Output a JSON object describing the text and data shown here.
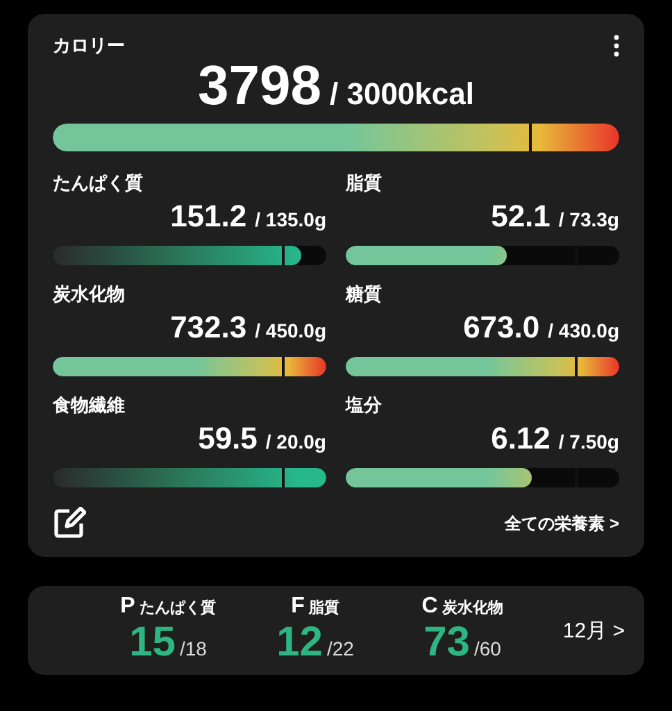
{
  "calorie": {
    "label": "カロリー",
    "value": "3798",
    "target": "/ 3000kcal",
    "level": 1.0,
    "kind": "warm"
  },
  "nutrients": [
    {
      "label": "たんぱく質",
      "value": "151.2",
      "target": "/ 135.0g",
      "level": 0.91,
      "kind": "teal"
    },
    {
      "label": "脂質",
      "value": "52.1",
      "target": "/ 73.3g",
      "level": 0.59,
      "kind": "warm"
    },
    {
      "label": "炭水化物",
      "value": "732.3",
      "target": "/ 450.0g",
      "level": 1.0,
      "kind": "warm"
    },
    {
      "label": "糖質",
      "value": "673.0",
      "target": "/ 430.0g",
      "level": 1.0,
      "kind": "warm"
    },
    {
      "label": "食物繊維",
      "value": "59.5",
      "target": "/ 20.0g",
      "level": 1.0,
      "kind": "teal"
    },
    {
      "label": "塩分",
      "value": "6.12",
      "target": "/ 7.50g",
      "level": 0.68,
      "kind": "warm"
    }
  ],
  "all_nutrients_link": "全ての栄養素 >",
  "pfc": [
    {
      "letter": "P",
      "label": "たんぱく質",
      "value": "15",
      "target": "/18"
    },
    {
      "letter": "F",
      "label": "脂質",
      "value": "12",
      "target": "/22"
    },
    {
      "letter": "C",
      "label": "炭水化物",
      "value": "73",
      "target": "/60"
    }
  ],
  "month_link": "12月 >"
}
